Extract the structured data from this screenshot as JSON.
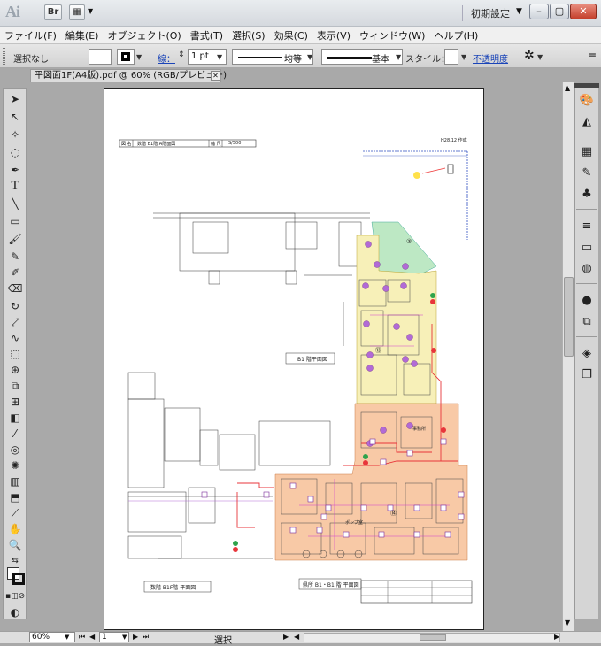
{
  "titlebar": {
    "logo": "Ai",
    "bridge_label": "Br",
    "workspace": "初期設定",
    "minimize": "–",
    "restore": "▢",
    "close": "✕"
  },
  "menu": [
    "ファイル(F)",
    "編集(E)",
    "オブジェクト(O)",
    "書式(T)",
    "選択(S)",
    "効果(C)",
    "表示(V)",
    "ウィンドウ(W)",
    "ヘルプ(H)"
  ],
  "control": {
    "selection": "選択なし",
    "stroke_label": "線：",
    "stroke_weight": "1 pt",
    "profile1": "均等",
    "profile2": "基本",
    "style_label": "スタイル：",
    "opacity_label": "不透明度"
  },
  "document": {
    "tab_title": "平図面1F(A4版).pdf @ 60% (RGB/プレビュー)",
    "tab_close": "✕"
  },
  "status": {
    "zoom": "60%",
    "page": "1",
    "tool": "選択"
  },
  "drawing": {
    "header_label": "図 名",
    "header_title": "数階 B1階 A階面図",
    "header_scale_label": "縮 尺",
    "header_scale": "S/500",
    "date_note": "H28.12 作成",
    "label_b1": "B1 階平面図",
    "label_1f_bottom": "数階 B1F階 平面図",
    "label_b1_1f": "県所 B1・B1 階 平面図",
    "room_numbers": [
      "③",
      "⑬",
      "⑭"
    ],
    "label_pump": "ポンプ室",
    "legend_note": "事務所"
  },
  "colors": {
    "accent_link": "#1a44b8",
    "zone_yellow": "#f7f0b8",
    "zone_orange": "#f8c9a6",
    "zone_green": "#bde8c4",
    "device_purple": "#b26ad6",
    "red_line": "#e8353b"
  }
}
